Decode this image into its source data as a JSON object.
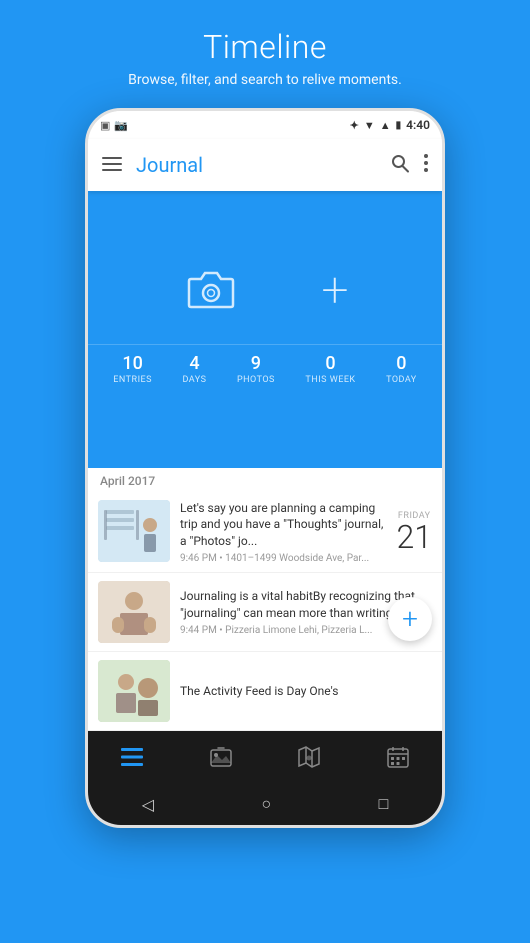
{
  "page": {
    "title": "Timeline",
    "subtitle": "Browse, filter, and search to relive moments."
  },
  "status_bar": {
    "left_icons": [
      "▣",
      "📷"
    ],
    "bluetooth": "✦",
    "wifi": "▼",
    "signal": "▲",
    "battery": "🔋",
    "time": "4:40"
  },
  "app_bar": {
    "title": "Journal",
    "menu_icon": "menu-icon",
    "search_icon": "search-icon",
    "more_icon": "more-icon"
  },
  "blue_area": {
    "camera_hint": "camera-icon",
    "add_hint": "add-icon"
  },
  "stats": [
    {
      "value": "10",
      "label": "ENTRIES"
    },
    {
      "value": "4",
      "label": "DAYS"
    },
    {
      "value": "9",
      "label": "PHOTOS"
    },
    {
      "value": "0",
      "label": "THIS WEEK"
    },
    {
      "value": "0",
      "label": "TODAY"
    }
  ],
  "section_header": "April 2017",
  "entries": [
    {
      "text": "Let's say you are planning a camping trip and you have a \"Thoughts\" journal, a \"Photos\" jo...",
      "meta": "9:46 PM • 1401–1499 Woodside Ave, Par...",
      "day_name": "FRIDAY",
      "day_num": "21",
      "has_thumb": true,
      "thumb_type": "1"
    },
    {
      "text": "Journaling is a vital habitBy recognizing that \"journaling\" can mean more than writing you...",
      "meta": "9:44 PM • Pizzeria Limone Lehi, Pizzeria L...",
      "day_name": "",
      "day_num": "",
      "has_thumb": true,
      "thumb_type": "2"
    },
    {
      "text": "The Activity Feed is Day One's",
      "meta": "",
      "day_name": "",
      "day_num": "",
      "has_thumb": true,
      "thumb_type": "3"
    }
  ],
  "bottom_nav": [
    {
      "icon": "☰",
      "active": true,
      "name": "timeline-nav"
    },
    {
      "icon": "🖼",
      "active": false,
      "name": "photos-nav"
    },
    {
      "icon": "🗺",
      "active": false,
      "name": "map-nav"
    },
    {
      "icon": "📅",
      "active": false,
      "name": "calendar-nav"
    }
  ],
  "fab": {
    "icon": "+",
    "label": "Add Entry"
  },
  "system_nav": {
    "back": "◁",
    "home": "○",
    "recent": "□"
  }
}
